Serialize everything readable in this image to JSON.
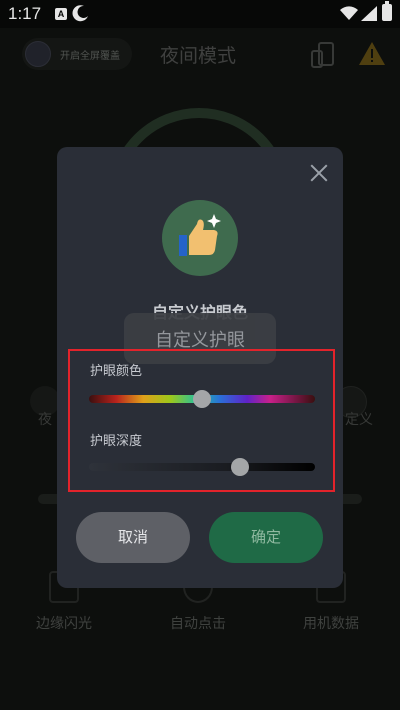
{
  "status_bar": {
    "time": "1:17",
    "a_badge": "A",
    "icons": [
      "moon-icon",
      "wifi-icon",
      "signal-icon",
      "battery-icon"
    ]
  },
  "background": {
    "header": {
      "fullscreen_label": "开启全屏覆盖",
      "title": "夜间模式",
      "icons": [
        "moon-icon",
        "phone-rotate-icon",
        "warning-icon"
      ]
    },
    "side_left_label": "夜",
    "side_right_label": "定义",
    "bottom_items": [
      {
        "label": "边缘闪光",
        "icon": "edge-flash-icon"
      },
      {
        "label": "自动点击",
        "icon": "auto-click-icon"
      },
      {
        "label": "用机数据",
        "icon": "usage-data-icon"
      }
    ]
  },
  "dialog": {
    "title": "自定义护眼色",
    "badge_icon": "thumbs-up-sparkle-icon",
    "eye_color_label": "护眼颜色",
    "eye_depth_label": "护眼深度",
    "eye_color_position": 0.5,
    "eye_depth_position": 0.67,
    "cancel_label": "取消",
    "confirm_label": "确定"
  },
  "toast": {
    "text": "自定义护眼"
  },
  "colors": {
    "dialog_bg": "#2a2e37",
    "confirm_green": "#1f6a46",
    "highlight_red": "#e3232b"
  }
}
